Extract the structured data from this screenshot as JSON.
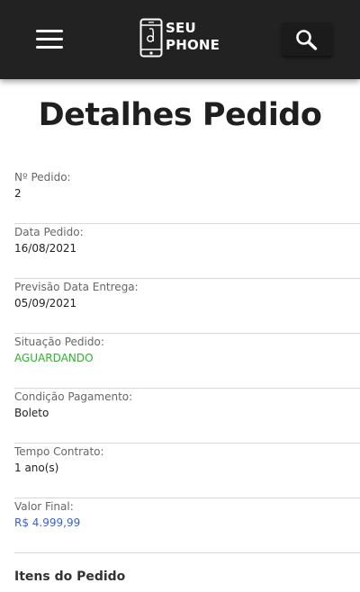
{
  "header": {
    "logo_line1": "SEU",
    "logo_line2": "PHONE",
    "colors": {
      "background": "#222222",
      "foreground": "#ffffff"
    },
    "menu_icon": "hamburger-menu-icon",
    "search_icon": "search-icon"
  },
  "page": {
    "title": "Detalhes Pedido",
    "section_title": "Itens do Pedido"
  },
  "details": [
    {
      "label": "Nº Pedido:",
      "value": "2",
      "color": "#222222"
    },
    {
      "label": "Data Pedido:",
      "value": "16/08/2021",
      "color": "#222222"
    },
    {
      "label": "Previsão Data Entrega:",
      "value": "05/09/2021",
      "color": "#222222"
    },
    {
      "label": "Situação Pedido:",
      "value": "AGUARDANDO",
      "color": "#2db52d"
    },
    {
      "label": "Condição Pagamento:",
      "value": "Boleto",
      "color": "#222222"
    },
    {
      "label": "Tempo Contrato:",
      "value": "1 ano(s)",
      "color": "#222222"
    },
    {
      "label": "Valor Final:",
      "value": "R$ 4.999,99",
      "color": "#3a62c9"
    }
  ]
}
